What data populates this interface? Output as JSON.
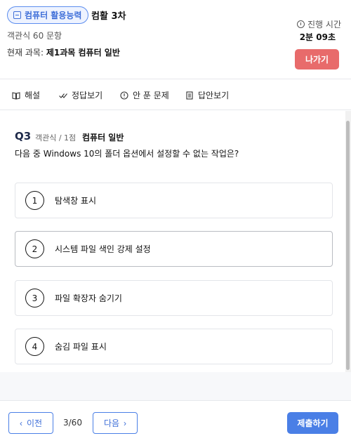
{
  "header": {
    "badge_label": "컴퓨터 활용능력",
    "exam_title": "컴활 3차",
    "question_type_count": "객관식 60 문항",
    "current_subject_label": "현재 과목:",
    "current_subject_value": "제1과목  컴퓨터 일반",
    "timer_label": "진행 시간",
    "timer_value": "2분 09초",
    "exit_label": "나가기"
  },
  "toolbar": {
    "explanation": "해설",
    "show_answer": "정답보기",
    "unsolved": "안 푼 문제",
    "answer_sheet": "답안보기"
  },
  "question": {
    "number": "Q3",
    "meta": "객관식 / 1점",
    "subject": "컴퓨터 일반",
    "text": "다음 중 Windows 10의 폴더 옵션에서 설정할 수 없는 작업은?",
    "options": [
      {
        "num": "1",
        "text": "탐색창 표시"
      },
      {
        "num": "2",
        "text": "시스템 파일 색인 강제 설정"
      },
      {
        "num": "3",
        "text": "파일 확장자 숨기기"
      },
      {
        "num": "4",
        "text": "숨김 파일 표시"
      }
    ]
  },
  "footer": {
    "prev_label": "이전",
    "page_indicator": "3/60",
    "next_label": "다음",
    "submit_label": "제출하기"
  },
  "colors": {
    "accent": "#4a7fe6",
    "exit": "#e86b6b"
  }
}
